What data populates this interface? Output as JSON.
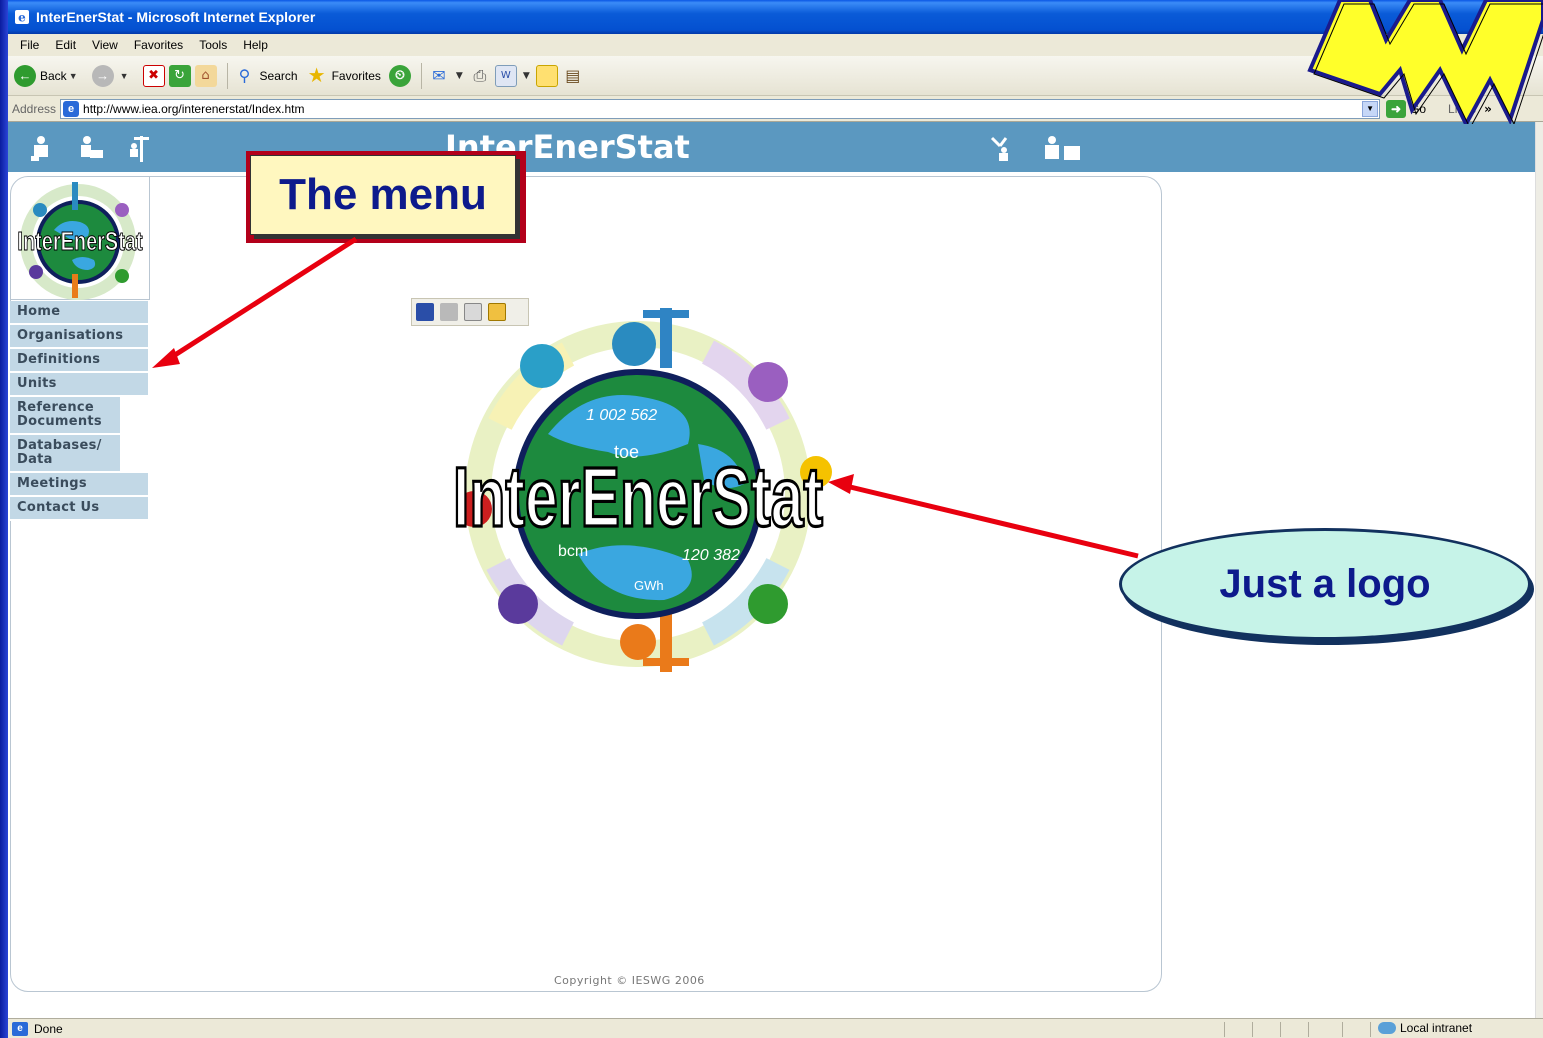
{
  "window": {
    "title": "InterEnerStat - Microsoft Internet Explorer"
  },
  "menubar": [
    "File",
    "Edit",
    "View",
    "Favorites",
    "Tools",
    "Help"
  ],
  "toolbar": {
    "back_label": "Back",
    "search_label": "Search",
    "favorites_label": "Favorites"
  },
  "addressbar": {
    "label": "Address",
    "url": "http://www.iea.org/interenerstat/Index.htm",
    "go_label": "Go",
    "links_label": "Links"
  },
  "site": {
    "title": "InterEnerStat",
    "logo_text": "InterEnerStat",
    "copyright": "Copyright © IESWG 2006"
  },
  "nav": [
    "Home",
    "Organisations",
    "Definitions",
    "Units",
    "Reference Documents",
    "Databases/ Data",
    "Meetings",
    "Contact Us"
  ],
  "logo_globe_labels": [
    "1 002 562",
    "toe",
    "bcm",
    "120 382",
    "GWh"
  ],
  "statusbar": {
    "status": "Done",
    "zone": "Local intranet"
  },
  "callouts": {
    "menu": "The menu",
    "logo": "Just a logo"
  },
  "colors": {
    "header": "#5b98c0",
    "nav_bg": "#c2d8e6",
    "callout_text": "#0d1a8c"
  }
}
